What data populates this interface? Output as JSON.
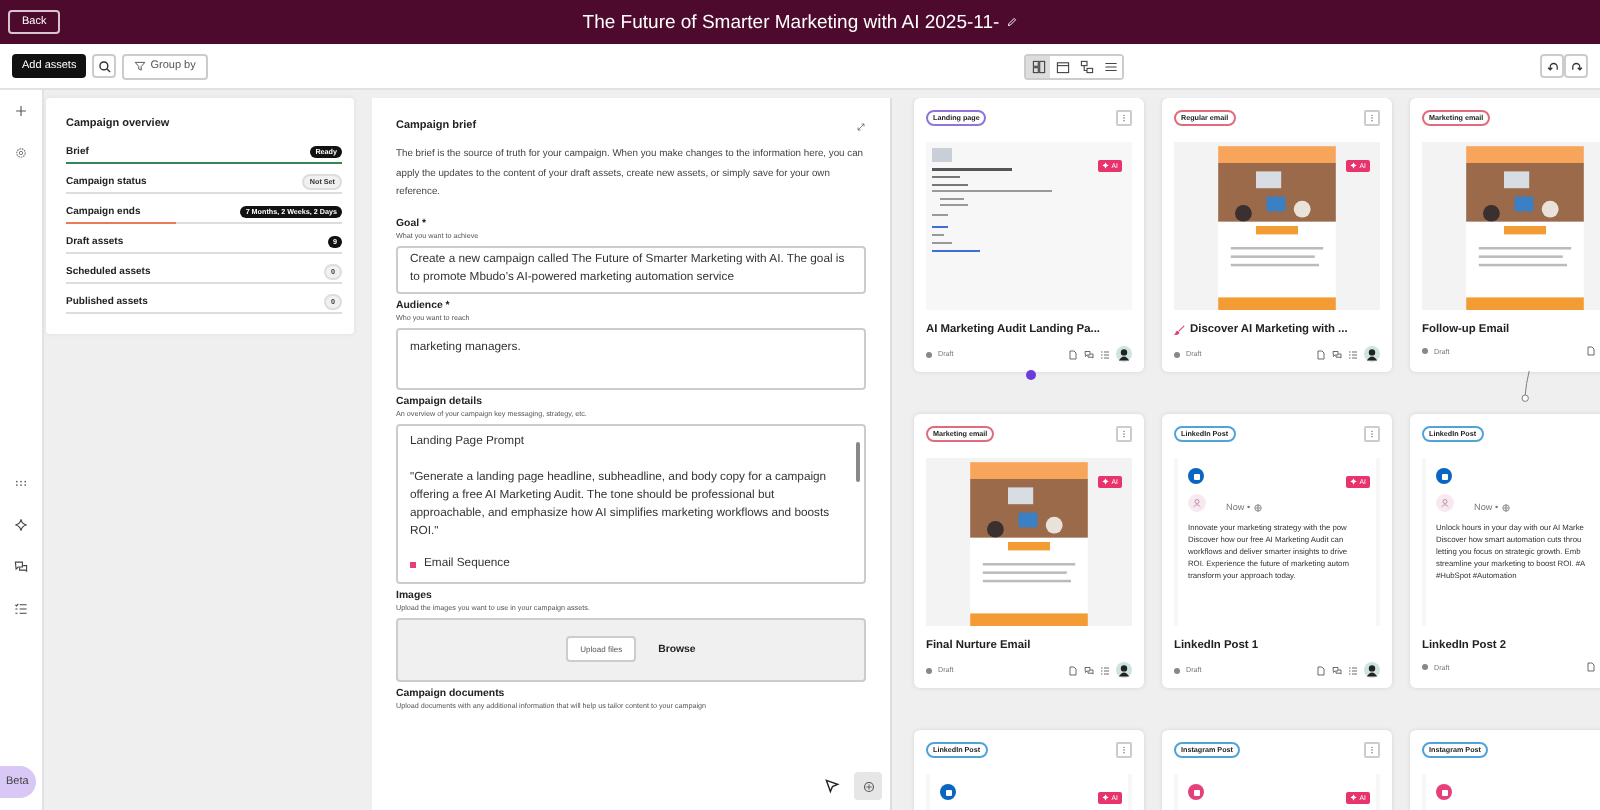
{
  "header": {
    "back": "Back",
    "title": "The Future of Smarter Marketing with AI 2025-11-"
  },
  "toolbar": {
    "add": "Add assets",
    "group_by": "Group by",
    "views": [
      {
        "kind": "board",
        "selected": true
      },
      {
        "kind": "calendar",
        "selected": false
      },
      {
        "kind": "flow",
        "selected": false
      },
      {
        "kind": "list",
        "selected": false
      }
    ]
  },
  "rail": {
    "beta": "Beta"
  },
  "overview": {
    "title": "Campaign overview",
    "items": [
      {
        "label": "Brief",
        "badge": {
          "text": "Ready",
          "kind": "dark"
        },
        "bar": {
          "level": 1,
          "color": "#2f8a55"
        }
      },
      {
        "label": "Campaign status",
        "badge": {
          "text": "Not Set",
          "kind": "light"
        }
      },
      {
        "label": "Campaign ends",
        "badge": {
          "text": "7 Months, 2 Weeks, 2 Days",
          "kind": "dark"
        },
        "bar": {
          "level": 0.4,
          "color": "#e8795a"
        }
      },
      {
        "label": "Draft assets",
        "badge": {
          "text": "9",
          "kind": "dark"
        }
      },
      {
        "label": "Scheduled assets",
        "badge": {
          "text": "0",
          "kind": "light"
        }
      },
      {
        "label": "Published assets",
        "badge": {
          "text": "0",
          "kind": "light"
        }
      }
    ]
  },
  "brief": {
    "title": "Campaign brief",
    "description": "The brief is the source of truth for your campaign. When you make changes to the information here, you can apply the updates to the content of your draft assets, create new assets, or simply save for your own reference.",
    "goal": {
      "label": "Goal *",
      "hint": "What you want to achieve",
      "value": "Create a new campaign called The Future of Smarter Marketing with AI. The goal is to promote Mbudo’s AI-powered marketing automation service"
    },
    "audience": {
      "label": "Audience *",
      "hint": "Who you want to reach",
      "value": "marketing managers."
    },
    "details": {
      "label": "Campaign details",
      "hint": "An overview of your campaign key messaging, strategy, etc.",
      "heading": "Landing Page Prompt",
      "quote": "\"Generate a landing page headline, subheadline, and body copy for a campaign offering a free AI Marketing Audit. The tone should be professional but approachable, and emphasize how AI simplifies marketing workflows and boosts ROI.\"",
      "bullet": "Email Sequence"
    },
    "images": {
      "label": "Images",
      "hint": "Upload the images you want to use in your campaign assets.",
      "upload": "Upload files",
      "browse": "Browse"
    },
    "documents": {
      "label": "Campaign documents",
      "hint": "Upload documents with any additional information that will help us tailor content to your campaign"
    }
  },
  "cards": [
    {
      "kind": "page",
      "tag": "Landing page",
      "color": "#8f74d9",
      "ai": "AI",
      "title": "AI Marketing Audit Landing Pa...",
      "status": "Draft",
      "avatar": true
    },
    {
      "kind": "email",
      "tag": "Regular email",
      "color": "#e06b7c",
      "ai": "AI",
      "title": "Discover AI Marketing with ...",
      "title_icon": true,
      "status": "Draft",
      "avatar": true
    },
    {
      "kind": "email",
      "tag": "Marketing email",
      "color": "#e06b7c",
      "title": "Follow-up Email",
      "status": "Draft",
      "avatar": false
    },
    {
      "kind": "email",
      "tag": "Marketing email",
      "color": "#e06b7c",
      "ai": "AI",
      "title": "Final Nurture Email",
      "status": "Draft",
      "avatar": true
    },
    {
      "kind": "social",
      "network": {
        "kind": "linkedin"
      },
      "tag": "LinkedIn Post",
      "color": "#4fa3d9",
      "ai": "AI",
      "time": "Now •",
      "lines": [
        "Innovate your marketing strategy with the pow",
        "Discover how our free AI Marketing Audit can",
        "workflows and deliver smarter insights to drive",
        "ROI. Experience the future of marketing autom",
        "transform your approach today."
      ],
      "title": "LinkedIn Post 1",
      "status": "Draft",
      "avatar": true
    },
    {
      "kind": "social",
      "network": {
        "kind": "linkedin"
      },
      "tag": "LinkedIn Post",
      "color": "#4fa3d9",
      "time": "Now •",
      "lines": [
        "Unlock hours in your day with our AI Marke",
        "Discover how smart automation cuts throu",
        "letting you focus on strategic growth. Emb",
        "streamline your marketing to boost ROI. #A",
        "#HubSpot #Automation"
      ],
      "title": "LinkedIn Post 2",
      "status": "Draft",
      "avatar": false
    },
    {
      "kind": "social",
      "network": {
        "kind": "linkedin"
      },
      "tag": "LinkedIn Post",
      "color": "#4fa3d9",
      "ai": "AI"
    },
    {
      "kind": "social",
      "network": {
        "kind": "instagram"
      },
      "tag": "Instagram Post",
      "color": "#4fa3d9",
      "ai": "AI"
    },
    {
      "kind": "social",
      "network": {
        "kind": "instagram"
      },
      "tag": "Instagram Post",
      "color": "#4fa3d9"
    }
  ]
}
